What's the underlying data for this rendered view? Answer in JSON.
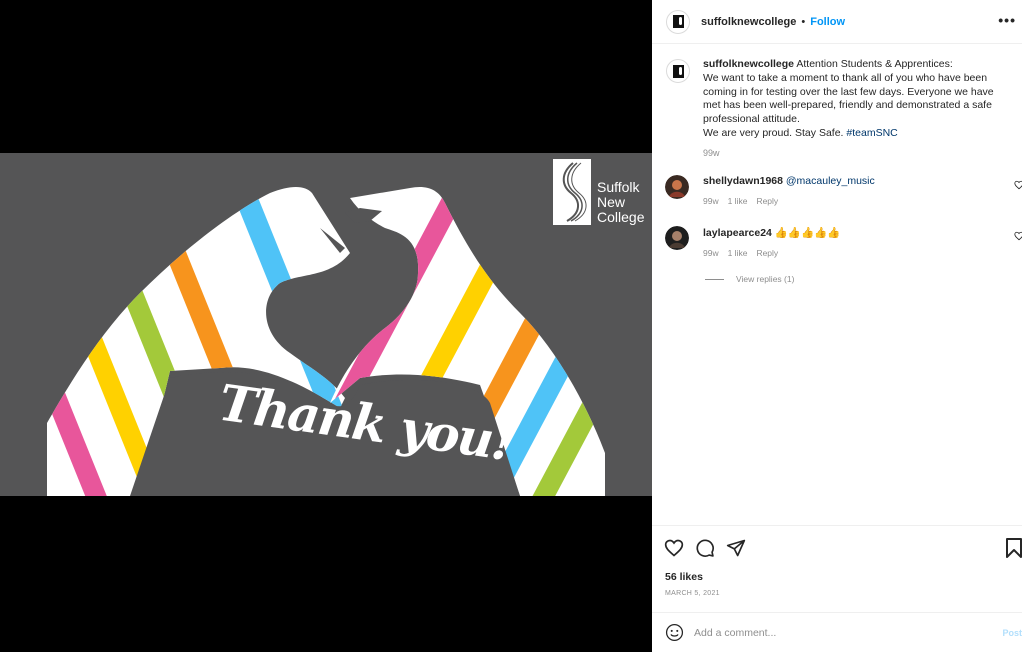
{
  "post": {
    "username": "suffolknewcollege",
    "separator": "•",
    "follow_label": "Follow",
    "more_label": "•••"
  },
  "image": {
    "logo_line1": "Suffolk",
    "logo_line2": "New",
    "logo_line3": "College",
    "headline": "Thank you!"
  },
  "caption": {
    "username": "suffolknewcollege",
    "line1": "Attention Students & Apprentices:",
    "line2": "We want to take a moment to thank all of you who have been coming in for testing over the last few days. Everyone we have met has been well-prepared, friendly and demonstrated a safe professional attitude.",
    "line3": "We are very proud. Stay Safe.",
    "hashtag": "#teamSNC",
    "time": "99w"
  },
  "comments": [
    {
      "username": "shellydawn1968",
      "text": "@macauley_music",
      "time": "99w",
      "likes": "1 like",
      "reply": "Reply"
    },
    {
      "username": "laylapearce24",
      "text": "👍👍👍👍👍",
      "time": "99w",
      "likes": "1 like",
      "reply": "Reply"
    }
  ],
  "view_replies": "View replies (1)",
  "likes_count": "56 likes",
  "date": "MARCH 5, 2021",
  "add_comment": {
    "placeholder": "Add a comment...",
    "post_label": "Post"
  },
  "colors": {
    "link": "#0095f6",
    "hashtag": "#00376b",
    "image_bg": "#555556"
  }
}
